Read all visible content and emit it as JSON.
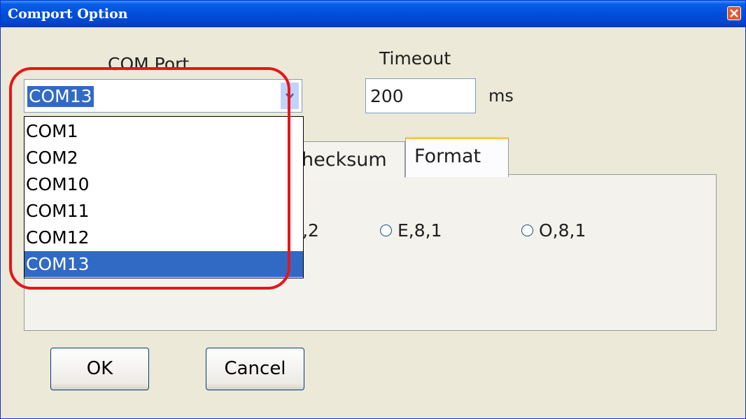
{
  "window": {
    "title": "Comport Option"
  },
  "comport": {
    "label": "COM Port",
    "selected": "COM13",
    "options": [
      "COM1",
      "COM2",
      "COM10",
      "COM11",
      "COM12",
      "COM13"
    ]
  },
  "timeout": {
    "label": "Timeout",
    "value": "200",
    "unit": "ms"
  },
  "tabs": [
    {
      "label": "hecksum"
    },
    {
      "label": "Format"
    }
  ],
  "format_options": [
    {
      "label": ",2"
    },
    {
      "label": "E,8,1"
    },
    {
      "label": "O,8,1"
    }
  ],
  "buttons": {
    "ok": "OK",
    "cancel": "Cancel"
  },
  "colors": {
    "highlight": "#e8141b",
    "selection": "#316ac5",
    "title_bar": "#0050dd"
  }
}
